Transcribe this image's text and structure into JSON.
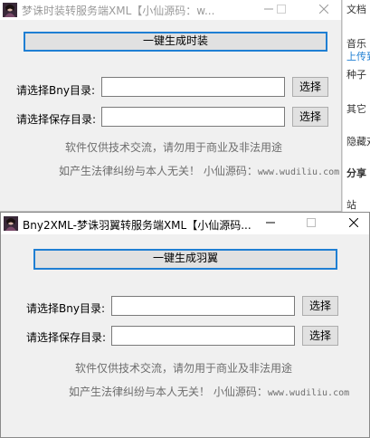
{
  "background_app": {
    "items": [
      "文档",
      "音乐",
      "上传到",
      "种子",
      "其它",
      "隐藏对",
      "分享",
      "站"
    ]
  },
  "window1": {
    "title": "梦诛时装转服务端XML【小仙源码：w...",
    "generate_label": "一键生成时装",
    "bny_label": "请选择Bny目录:",
    "bny_value": "",
    "save_label": "请选择保存目录:",
    "save_value": "",
    "choose_label": "选择",
    "choose_label2": "选择",
    "disclaimer": "软件仅供技术交流，请勿用于商业及非法用途",
    "notice_prefix": "如产生法律纠纷与本人无关！ 小仙源码：",
    "notice_url": "www.wudiliu.com"
  },
  "window2": {
    "title": "Bny2XML-梦诛羽翼转服务端XML【小仙源码...",
    "generate_label": "一键生成羽翼",
    "bny_label": "请选择Bny目录:",
    "bny_value": "",
    "save_label": "请选择保存目录:",
    "save_value": "",
    "choose_label": "选择",
    "choose_label2": "选择",
    "disclaimer": "软件仅供技术交流，请勿用于商业及非法用途",
    "notice_prefix": "如产生法律纠纷与本人无关！ 小仙源码：",
    "notice_url": "www.wudiliu.com"
  },
  "colors": {
    "accent": "#1f7fd3",
    "window_bg": "#f0f0f0",
    "muted_text": "#6d6d6d"
  },
  "icons": [
    "app-avatar-icon",
    "minimize-icon",
    "maximize-icon",
    "close-icon"
  ]
}
